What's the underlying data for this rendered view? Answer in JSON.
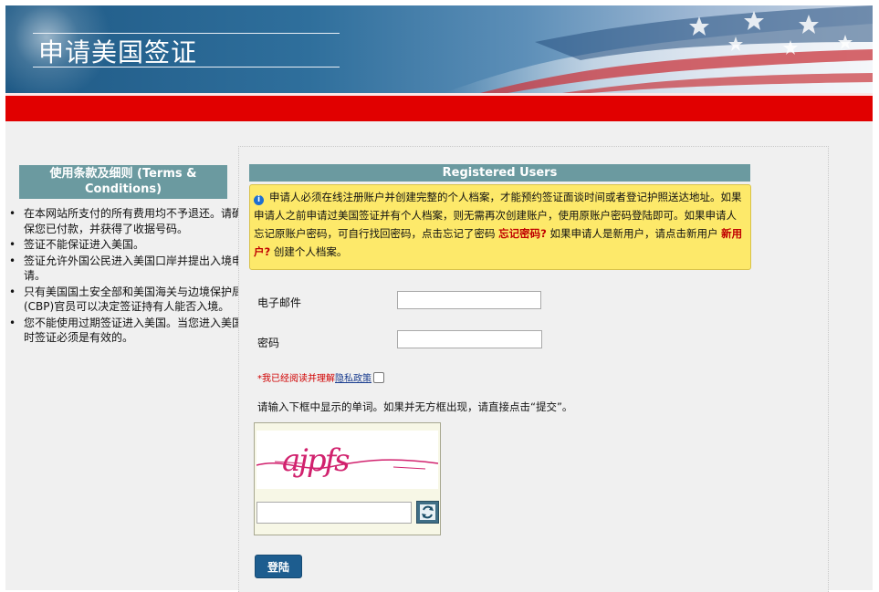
{
  "header": {
    "title": "申请美国签证"
  },
  "terms": {
    "heading": "使用条款及细则 (Terms & Conditions)",
    "bullet": "•",
    "items": [
      "在本网站所支付的所有费用均不予退还。请确保您已付款，并获得了收据号码。",
      "签证不能保证进入美国。",
      "签证允许外国公民进入美国口岸并提出入境申请。",
      "只有美国国土安全部和美国海关与边境保护局(CBP)官员可以决定签证持有人能否入境。",
      "您不能使用过期签证进入美国。当您进入美国时签证必须是有效的。"
    ]
  },
  "registered": {
    "heading": "Registered Users",
    "notice_part1": "申请人必须在线注册账户并创建完整的个人档案，才能预约签证面谈时间或者登记护照送达地址。如果申请人之前申请过美国签证并有个人档案，则无需再次创建账户，使用原账户密码登陆即可。如果申请人忘记原账户密码，可自行找回密码，点击忘记了密码 ",
    "forgot_link": "忘记密码?",
    "notice_part2": " 如果申请人是新用户，请点击新用户 ",
    "new_user_link": "新用户?",
    "notice_part3": " 创建个人档案。"
  },
  "form": {
    "email_label": "电子邮件",
    "password_label": "密码",
    "privacy_prefix": "*我已经阅读并理解",
    "privacy_link": "隐私政策",
    "captcha_instructions": "请输入下框中显示的单词。如果并无方框出现，请直接点击“提交”。",
    "captcha_text": "ajpfs",
    "login_button": "登陆"
  },
  "colors": {
    "banner_blue": "#2f6f9c",
    "red_bar": "#e10000",
    "section_header": "#6b9aa0",
    "notice_bg": "#fde96a",
    "link_red": "#c00000",
    "button_blue": "#1d5d8f"
  }
}
